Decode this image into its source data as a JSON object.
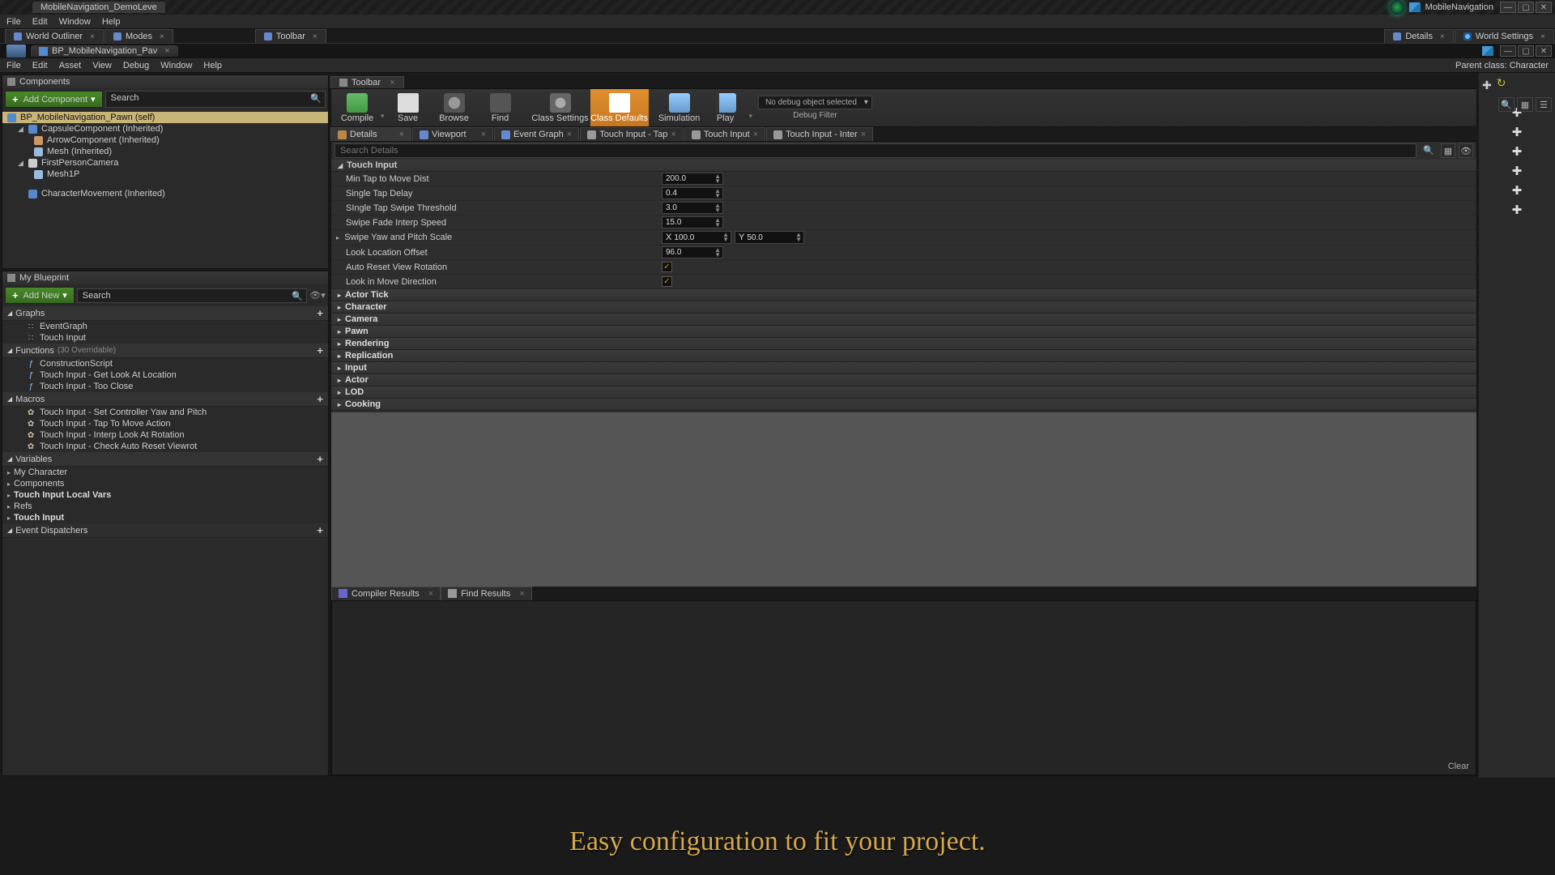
{
  "title_tab": "MobileNavigation_DemoLeve",
  "source_label": "MobileNavigation",
  "level_menu": [
    "File",
    "Edit",
    "Window",
    "Help"
  ],
  "level_tabs": [
    "World Outliner",
    "Modes",
    "Toolbar"
  ],
  "level_tabs_right": [
    "Details",
    "World Settings"
  ],
  "bp_tab": "BP_MobileNavigation_Pav",
  "bp_menu": [
    "File",
    "Edit",
    "Asset",
    "View",
    "Debug",
    "Window",
    "Help"
  ],
  "parent_class_label": "Parent class:",
  "parent_class": "Character",
  "components": {
    "panel_title": "Components",
    "add_label": "Add Component",
    "search_placeholder": "Search",
    "root": "BP_MobileNavigation_Pawn (self)",
    "tree": [
      {
        "name": "CapsuleComponent (Inherited)",
        "indent": 1,
        "open": true,
        "ico": "blue"
      },
      {
        "name": "ArrowComponent (Inherited)",
        "indent": 2,
        "ico": "orange"
      },
      {
        "name": "Mesh (Inherited)",
        "indent": 2,
        "ico": "mesh"
      },
      {
        "name": "FirstPersonCamera",
        "indent": 1,
        "open": true,
        "ico": "cam"
      },
      {
        "name": "Mesh1P",
        "indent": 2,
        "ico": "mesh"
      },
      {
        "name": "CharacterMovement (Inherited)",
        "indent": 1,
        "ico": "blue",
        "gap": true
      }
    ]
  },
  "myblueprint": {
    "panel_title": "My Blueprint",
    "add_label": "Add New",
    "search_placeholder": "Search",
    "graphs_label": "Graphs",
    "graphs": [
      "EventGraph",
      "Touch Input"
    ],
    "functions_label": "Functions",
    "functions_sub": "(30 Overridable)",
    "functions": [
      "ConstructionScript",
      "Touch Input - Get Look At Location",
      "Touch Input - Too Close"
    ],
    "macros_label": "Macros",
    "macros": [
      "Touch Input - Set Controller Yaw and Pitch",
      "Touch Input - Tap To Move Action",
      "Touch Input - Interp Look At Rotation",
      "Touch Input - Check Auto Reset Viewrot"
    ],
    "variables_label": "Variables",
    "variables": [
      "My Character",
      "Components",
      "Touch Input Local Vars",
      "Refs",
      "Touch Input"
    ],
    "dispatchers_label": "Event Dispatchers"
  },
  "toolbar_tab": "Toolbar",
  "toolbar_buttons": {
    "compile": "Compile",
    "save": "Save",
    "browse": "Browse",
    "find": "Find",
    "csettings": "Class Settings",
    "cdefaults": "Class Defaults",
    "sim": "Simulation",
    "play": "Play"
  },
  "debug_selected": "No debug object selected",
  "debug_filter": "Debug Filter",
  "center_tabs": [
    "Details",
    "Viewport",
    "Event Graph",
    "Touch Input - Tap",
    "Touch Input",
    "Touch Input - Inter"
  ],
  "details_search_placeholder": "Search Details",
  "touch_input_header": "Touch Input",
  "props": [
    {
      "label": "Min Tap to Move Dist",
      "type": "num",
      "value": "200.0"
    },
    {
      "label": "Single Tap Delay",
      "type": "num",
      "value": "0.4"
    },
    {
      "label": "SIngle Tap Swipe Threshold",
      "type": "num",
      "value": "3.0"
    },
    {
      "label": "Swipe Fade Interp Speed",
      "type": "num",
      "value": "15.0"
    },
    {
      "label": "Swipe Yaw and Pitch Scale",
      "type": "vec",
      "x": "100.0",
      "y": "50.0",
      "expand": true
    },
    {
      "label": "Look Location Offset",
      "type": "num",
      "value": "96.0"
    },
    {
      "label": "Auto Reset View Rotation",
      "type": "bool",
      "value": true
    },
    {
      "label": "Look in Move Direction",
      "type": "bool",
      "value": true
    }
  ],
  "collapsed_cats": [
    "Actor Tick",
    "Character",
    "Camera",
    "Pawn",
    "Rendering",
    "Replication",
    "Input",
    "Actor",
    "LOD",
    "Cooking"
  ],
  "results_tabs": [
    "Compiler Results",
    "Find Results"
  ],
  "clear_label": "Clear",
  "caption": "Easy configuration to fit your project."
}
